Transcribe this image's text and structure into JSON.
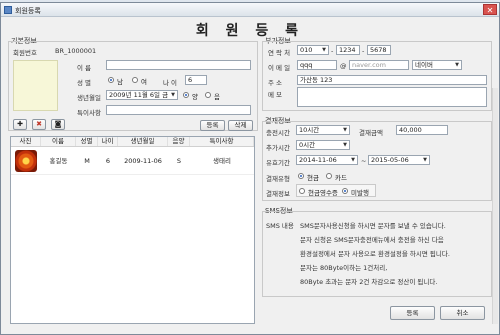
{
  "window": {
    "title": "회원등록",
    "heading": "회 원 등 록"
  },
  "basic": {
    "group_title": "기본정보",
    "member_no_label": "회원번호",
    "member_no": "BR_1000001",
    "name_label": "이   름",
    "name": "",
    "gender_label": "성   별",
    "gender_options": [
      "남",
      "여"
    ],
    "gender_selected": "남",
    "age_label": "나 이",
    "age": "6",
    "birth_label": "생년월일",
    "birth": "2009년 11월  6일 금",
    "calendar_options": [
      "양",
      "음"
    ],
    "calendar_selected": "양",
    "special_label": "특이사항",
    "special": "",
    "register_button": "등록",
    "delete_button": "삭제"
  },
  "table": {
    "columns": [
      "사진",
      "이름",
      "성별",
      "나이",
      "생년월일",
      "음양",
      "특이사항"
    ],
    "rows": [
      {
        "name": "홍길동",
        "gender": "M",
        "age": "6",
        "birth": "2009-11-06",
        "calendar": "S",
        "special": "생태리"
      }
    ]
  },
  "contact": {
    "group_title": "부가정보",
    "phone_label": "연 락 처",
    "phone_prefix": "010",
    "phone_mid": "1234",
    "phone_last": "5678",
    "email_label": "이 메 일",
    "email_id": "qqq",
    "email_domain_placeholder": "naver.com",
    "email_select": "네이버",
    "address_label": "주   소",
    "address": "가산동 123",
    "memo_label": "메   모",
    "memo": ""
  },
  "payment": {
    "group_title": "결재정보",
    "charge_time_label": "충전시간",
    "charge_time": "10시간",
    "amount_label": "결재금액",
    "amount": "40,000",
    "extra_time_label": "추가시간",
    "extra_time": "0시간",
    "period_label": "유효기간",
    "period_start": "2014-11-06",
    "period_end": "2015-05-06",
    "method_label": "결재유형",
    "methods": [
      "현금",
      "카드"
    ],
    "method_selected": "현금",
    "info_label": "결재정보",
    "info_options": [
      "현금영수증",
      "미발행"
    ],
    "info_selected": "미발행"
  },
  "sms": {
    "group_title": "SMS정보",
    "label": "SMS 내용",
    "lines": [
      "SMS문자사용신청을 하시면 문자를 보낼 수 있습니다.",
      "문자 신청은 SMS문자충전메뉴에서 충전을 하신 다음",
      "환경설정에서 문자 사용으로 환경설정을 하시면 됩니다.",
      "문자는 80Byte이하는 1건처리,",
      "80Byte 초과는 문자 2건 차감으로 정산이 됩니다."
    ]
  },
  "footer": {
    "ok_button": "등록",
    "cancel_button": "취소"
  }
}
